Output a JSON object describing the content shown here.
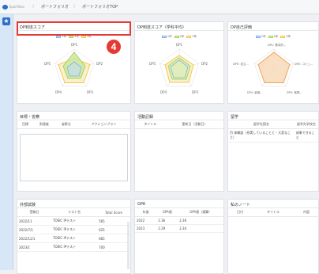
{
  "header": {
    "logo_text": "Eportfolio",
    "breadcrumb": [
      "ポートフォリオ",
      "ポートフォリオTOP"
    ]
  },
  "panels": {
    "dp_score": {
      "title": "DP到達スコア",
      "badge": "4"
    },
    "dp_score_avg": {
      "title": "DP到達スコア（学科平均）"
    },
    "dp_self": {
      "title": "DP自己評価"
    },
    "goals": {
      "title": "目標・省察",
      "cols": [
        "目標",
        "到達度",
        "省察点",
        "アクションプラン"
      ]
    },
    "activities": {
      "title": "活動記録",
      "cols": [
        "タイトル",
        "更新日（活動日）"
      ]
    },
    "study_abroad": {
      "title": "留学",
      "cols": [
        "留学先国名",
        "留学先学校名"
      ],
      "note": "目 体験談（充実していることと・大変なこと）",
      "note2": "成果できること"
    },
    "external_test": {
      "title": "外部試験",
      "cols": [
        "受験日",
        "テスト名",
        "Total Score"
      ],
      "rows": [
        {
          "date": "2022/11",
          "test": "TOEIC IPテスト",
          "score": "565"
        },
        {
          "date": "2022/7/1",
          "test": "TOEIC IPテスト",
          "score": "625"
        },
        {
          "date": "2022/12/1",
          "test": "TOEIC IPテスト",
          "score": "665"
        },
        {
          "date": "2023/1",
          "test": "TOEIC IPテスト",
          "score": "700"
        }
      ]
    },
    "gpa": {
      "title": "GPA",
      "cols": [
        "年度",
        "GPA値",
        "GPA値（通算）"
      ],
      "rows": [
        {
          "year": "2022",
          "gpa": "2.36",
          "total": "2.36"
        },
        {
          "year": "2023",
          "gpa": "2.29",
          "total": "2.34"
        }
      ]
    },
    "notes": {
      "title": "私のノート",
      "cols": [
        "日付",
        "タイトル",
        "内容"
      ]
    }
  },
  "radar_legend": [
    "1年",
    "2年",
    "3年"
  ],
  "radar_labels": {
    "dp_score": [
      "DP1",
      "DP2",
      "DP3",
      "DP4",
      "DP5"
    ],
    "dp_score_avg": [
      "DP1",
      "DP2",
      "DP3",
      "DP4",
      "DP5"
    ],
    "dp_self": [
      "DP1: 基本的...",
      "DP2: コミュ...",
      "DP3: 実践...",
      "DP4: 創造...",
      "DP5: 自立..."
    ]
  },
  "colors": {
    "yr1": "#7fb3e6",
    "yr2": "#a7d35a",
    "yr3": "#f3c649",
    "self": "#f0a25a",
    "accent": "#e53935"
  }
}
